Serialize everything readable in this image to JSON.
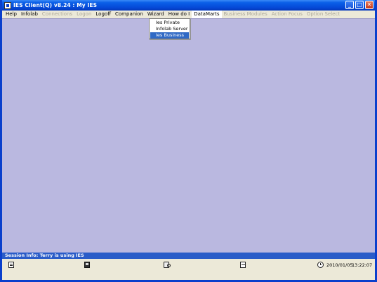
{
  "window": {
    "title": "IES Client(Q) v8.24 : My IES",
    "buttons": {
      "minimize": "_",
      "maximize": "□",
      "close": "✕"
    }
  },
  "menubar": {
    "items": [
      {
        "label": "Help",
        "enabled": true
      },
      {
        "label": "Infolab",
        "enabled": true
      },
      {
        "label": "Connections",
        "enabled": false
      },
      {
        "label": "Logon",
        "enabled": false
      },
      {
        "label": "Logoff",
        "enabled": true
      },
      {
        "label": "Companion",
        "enabled": true
      },
      {
        "label": "Wizard",
        "enabled": true
      },
      {
        "label": "How do I",
        "enabled": true
      },
      {
        "label": "DataMarts",
        "enabled": true,
        "open": true
      },
      {
        "label": "Business Modules",
        "enabled": false
      },
      {
        "label": "Action Focus",
        "enabled": false
      },
      {
        "label": "Option Select",
        "enabled": false
      }
    ]
  },
  "dropdown": {
    "items": [
      {
        "label": "Ies Private",
        "selected": false
      },
      {
        "label": "Infolab Server",
        "selected": false
      },
      {
        "label": "Ies Business",
        "selected": true
      }
    ]
  },
  "session": {
    "info": "Session Info: Terry is using IES"
  },
  "statusbar": {
    "date": "2010/01/05",
    "time": "13:22:07",
    "icons": [
      "document-icon",
      "save-icon",
      "tool-icon",
      "swap-icon",
      "clock-icon"
    ]
  },
  "colors": {
    "titlebar": "#0548d6",
    "client_background": "#bab8e0",
    "session_bar": "#2a5cc8",
    "menu_selected": "#316ac5"
  }
}
